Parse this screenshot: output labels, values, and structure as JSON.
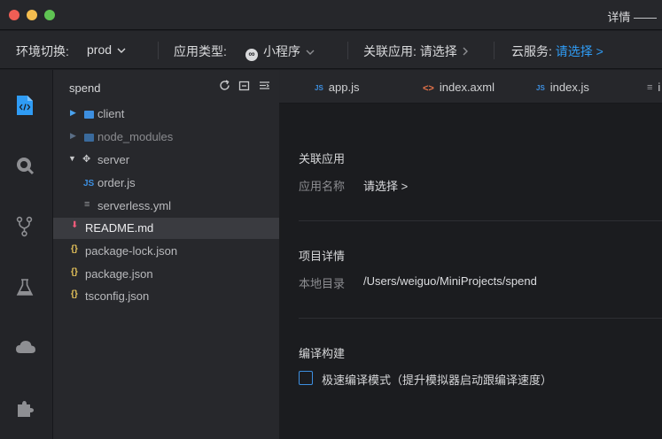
{
  "window": {
    "title": "详情 ——"
  },
  "toolbar": {
    "env_label": "环境切换:",
    "env_value": "prod",
    "app_type_label": "应用类型:",
    "app_type_value": "小程序",
    "linked_app_label": "关联应用:",
    "linked_app_value": "请选择",
    "cloud_label": "云服务:",
    "cloud_value": "请选择 >"
  },
  "activity_bar": {
    "items": [
      "code-icon",
      "debug-icon",
      "source-control-icon",
      "test-icon",
      "cloud-icon",
      "extensions-icon"
    ]
  },
  "explorer": {
    "title": "spend",
    "tree": [
      {
        "label": "client",
        "type": "folder",
        "expanded": false
      },
      {
        "label": "node_modules",
        "type": "folder",
        "expanded": false
      },
      {
        "label": "server",
        "type": "folder",
        "expanded": true
      },
      {
        "label": "order.js",
        "type": "js"
      },
      {
        "label": "serverless.yml",
        "type": "yml"
      },
      {
        "label": "README.md",
        "type": "md",
        "selected": true
      },
      {
        "label": "package-lock.json",
        "type": "json"
      },
      {
        "label": "package.json",
        "type": "json"
      },
      {
        "label": "tsconfig.json",
        "type": "json"
      }
    ]
  },
  "tabs": [
    {
      "label": "app.js",
      "icon": "JS"
    },
    {
      "label": "index.axml",
      "icon": "<>"
    },
    {
      "label": "index.js",
      "icon": "JS"
    },
    {
      "label": "i",
      "icon": "≡"
    }
  ],
  "details": {
    "linked_app": {
      "title": "关联应用",
      "name_label": "应用名称",
      "name_value": "请选择  >"
    },
    "project": {
      "title": "项目详情",
      "dir_label": "本地目录",
      "dir_value": "/Users/weiguo/MiniProjects/spend"
    },
    "build": {
      "title": "编译构建",
      "fast_compile_label": "极速编译模式（提升模拟器启动跟编译速度）",
      "fast_compile_checked": false
    }
  },
  "colors": {
    "accent": "#2f9cf5",
    "readme_icon": "#ef5b7b",
    "json_icon": "#e6c35a"
  }
}
